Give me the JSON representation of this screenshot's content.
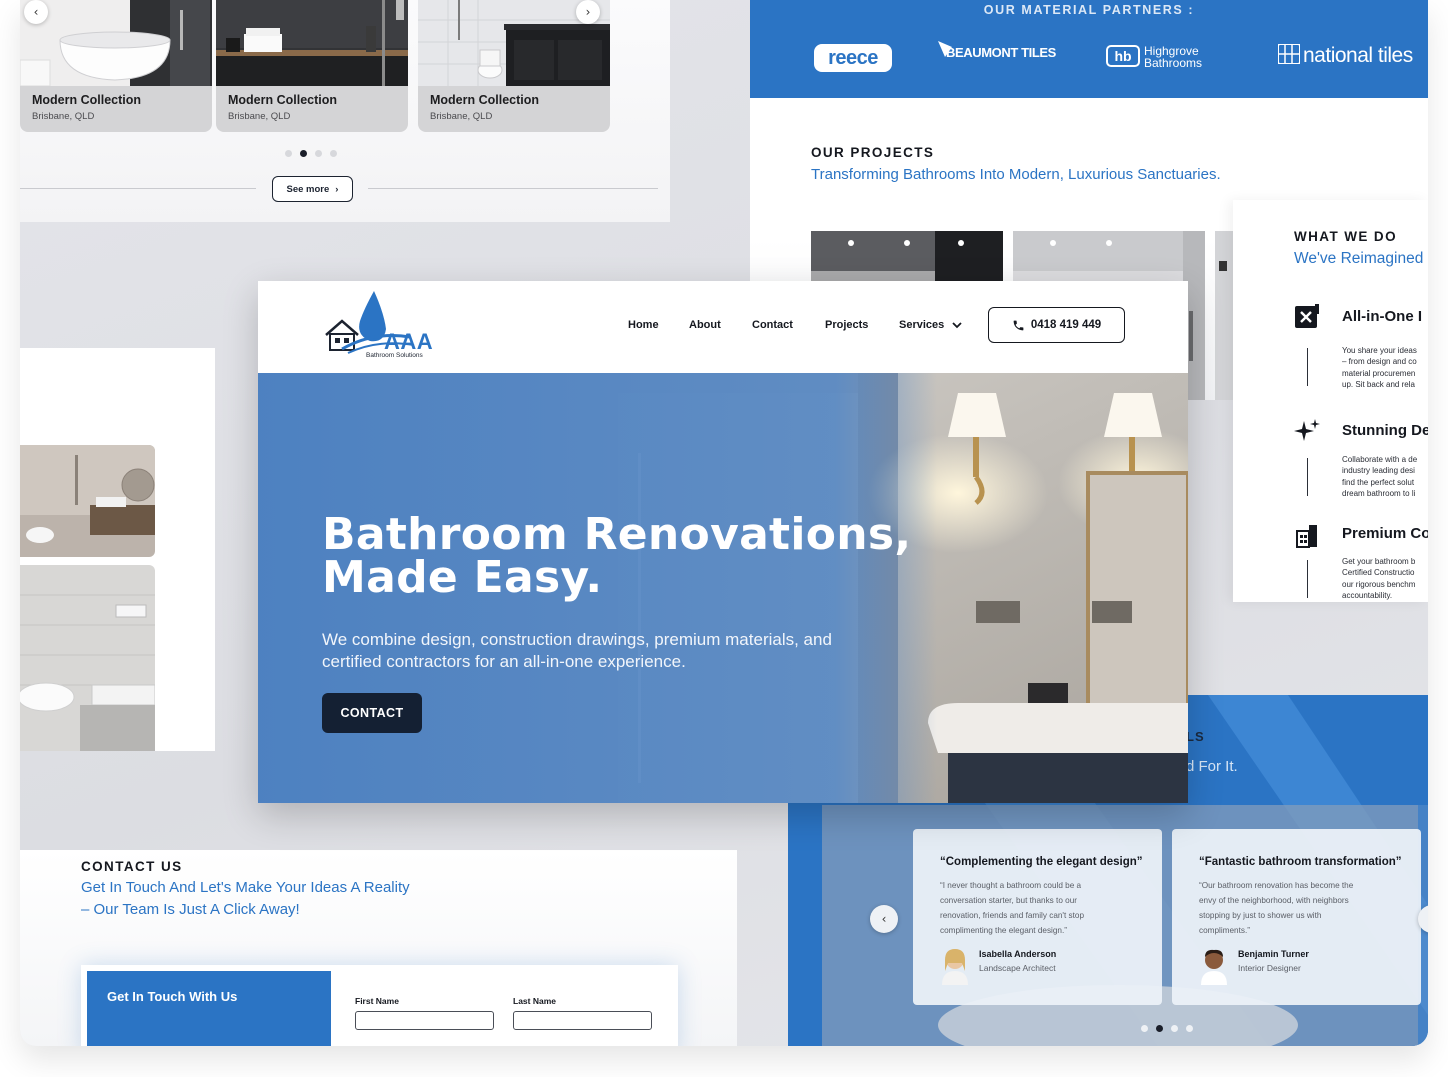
{
  "carousel": {
    "cards": [
      {
        "title": "Modern Collection",
        "location": "Brisbane, QLD"
      },
      {
        "title": "Modern Collection",
        "location": "Brisbane, QLD"
      },
      {
        "title": "Modern Collection",
        "location": "Brisbane, QLD"
      }
    ],
    "active_dot": 2,
    "dot_count": 4,
    "see_more_label": "See more",
    "prev_icon": "chevron-left-icon",
    "next_icon": "chevron-right-icon"
  },
  "partners": {
    "title": "OUR MATERIAL PARTNERS :",
    "logos": [
      "reece",
      "BEAUMONT TILES",
      "hb",
      "Highgrove",
      "Bathrooms",
      "national tiles"
    ]
  },
  "projects": {
    "eyebrow": "OUR PROJECTS",
    "subtitle": "Transforming Bathrooms Into Modern, Luxurious Sanctuaries."
  },
  "what_we_do": {
    "eyebrow": "WHAT WE DO",
    "subtitle": "We've Reimagined",
    "items": [
      {
        "icon": "tools-icon",
        "title": "All-in-One I",
        "body": "You share your ideas\n– from design and co\nmaterial procuremen\nup. Sit back and rela"
      },
      {
        "icon": "sparkles-icon",
        "title": "Stunning De",
        "body": "Collaborate with a de\nindustry leading desi\nfind the perfect solut\ndream bathroom to li"
      },
      {
        "icon": "building-icon",
        "title": "Premium Co",
        "body": "Get your bathroom b\nCertified Constructio\nour rigorous benchm\naccountability."
      }
    ]
  },
  "hero": {
    "logo_letters": "AAA",
    "logo_tagline": "Bathroom Solutions",
    "nav": [
      "Home",
      "About",
      "Contact",
      "Projects",
      "Services"
    ],
    "phone": "0418 419 449",
    "title_line1": "Bathroom Renovations,",
    "title_line2": "Made Easy.",
    "subtitle": "We combine design, construction drawings, premium materials, and certified contractors for an all-in-one experience.",
    "cta": "CONTACT"
  },
  "testimonials_section": {
    "heading_fragment": "LS",
    "subtitle_fragment": "d For It.",
    "items": [
      {
        "quote_title": "“Complementing the elegant design”",
        "body": "“I never thought a bathroom could be a\nconversation starter, but thanks to our\nrenovation, friends and family can't stop\ncomplimenting the elegant design.”",
        "name": "Isabella Anderson",
        "role": "Landscape Architect"
      },
      {
        "quote_title": "“Fantastic bathroom transformation”",
        "body": "“Our bathroom renovation has become the\nenvy of the neighborhood, with neighbors\nstopping by just to shower us with\ncompliments.”",
        "name": "Benjamin Turner",
        "role": "Interior Designer"
      }
    ],
    "active_dot": 2,
    "dot_count": 4
  },
  "contact": {
    "eyebrow": "CONTACT US",
    "subtitle_line1": "Get In Touch And Let's Make Your Ideas A Reality",
    "subtitle_line2": "– Our Team Is Just A Click Away!",
    "form_title": "Get In Touch With Us",
    "first_name_label": "First Name",
    "last_name_label": "Last Name"
  },
  "colors": {
    "brand_blue": "#2b74c4",
    "navy": "#142033",
    "dark_text": "#15181f"
  }
}
